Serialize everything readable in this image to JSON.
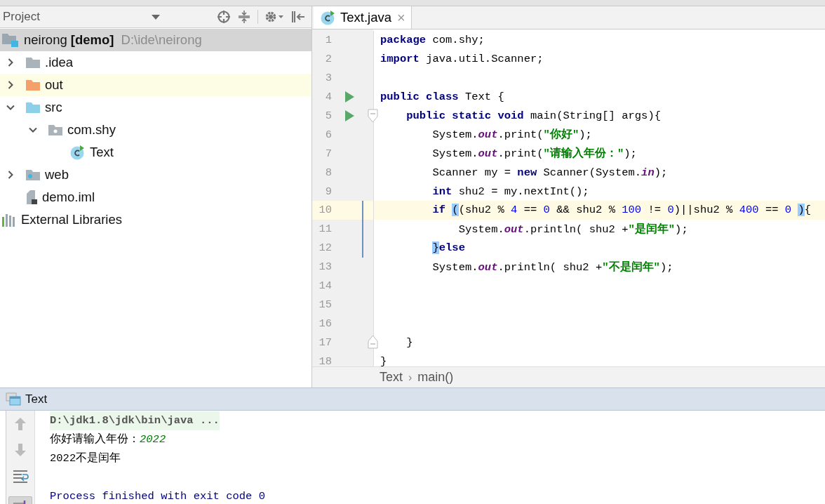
{
  "project_panel": {
    "title": "Project",
    "tree": [
      {
        "label": "neirong **[demo]**",
        "path": "D:\\ide\\neirong",
        "kind": "module",
        "selected": true,
        "highlighted": false,
        "children": [
          {
            "label": ".idea",
            "kind": "folder",
            "color": "#aab2ba",
            "expanded": false,
            "selected": false,
            "highlighted": false
          },
          {
            "label": "out",
            "kind": "folder",
            "color": "#f4a06b",
            "expanded": false,
            "selected": false,
            "highlighted": true
          },
          {
            "label": "src",
            "kind": "folder",
            "color": "#8cd0ea",
            "expanded": true,
            "selected": false,
            "highlighted": false,
            "children": [
              {
                "label": "com.shy",
                "kind": "package",
                "expanded": true,
                "selected": false,
                "highlighted": false,
                "children": [
                  {
                    "label": "Text",
                    "kind": "class",
                    "selected": false,
                    "highlighted": false
                  }
                ]
              }
            ]
          },
          {
            "label": "web",
            "kind": "web-folder",
            "expanded": false,
            "selected": false,
            "highlighted": false
          },
          {
            "label": "demo.iml",
            "kind": "file",
            "selected": false,
            "highlighted": false
          }
        ]
      },
      {
        "label": "External Libraries",
        "kind": "library",
        "selected": false,
        "highlighted": false
      }
    ]
  },
  "editor": {
    "tabs": [
      {
        "label": "Text.java",
        "close": "×",
        "selected": true
      }
    ],
    "lines": [
      {
        "number": "1",
        "current": false,
        "tokens": [
          {
            "t": "package",
            "kind": "kw"
          },
          {
            "t": " com.shy;",
            "kind": "plain"
          }
        ]
      },
      {
        "number": "2",
        "current": false,
        "tokens": [
          {
            "t": "import",
            "kind": "kw"
          },
          {
            "t": " java.util.Scanner;",
            "kind": "plain"
          }
        ]
      },
      {
        "number": "3",
        "current": false
      },
      {
        "number": "4",
        "current": false,
        "run": true,
        "tokens": [
          {
            "t": "public class",
            "kind": "kw"
          },
          {
            "t": " Text {",
            "kind": "plain"
          }
        ]
      },
      {
        "number": "5",
        "current": false,
        "run": true,
        "fold_marker": {
          "kind": "start"
        },
        "tokens": [
          {
            "t": "    public static void",
            "kind": "kw"
          },
          {
            "t": " main(String[] args){",
            "kind": "plain"
          }
        ]
      },
      {
        "number": "6",
        "current": false,
        "tokens": [
          {
            "t": "        System.",
            "kind": "plain"
          },
          {
            "t": "out",
            "kind": "field"
          },
          {
            "t": ".print(",
            "kind": "plain"
          },
          {
            "t": "\"你好\"",
            "kind": "str"
          },
          {
            "t": ");",
            "kind": "plain"
          }
        ]
      },
      {
        "number": "7",
        "current": false,
        "tokens": [
          {
            "t": "        System.",
            "kind": "plain"
          },
          {
            "t": "out",
            "kind": "field"
          },
          {
            "t": ".print(",
            "kind": "plain"
          },
          {
            "t": "\"请输入年份：\"",
            "kind": "str"
          },
          {
            "t": ");",
            "kind": "plain"
          }
        ]
      },
      {
        "number": "8",
        "current": false,
        "tokens": [
          {
            "t": "        Scanner my = ",
            "kind": "plain"
          },
          {
            "t": "new",
            "kind": "kw"
          },
          {
            "t": " Scanner(System.",
            "kind": "plain"
          },
          {
            "t": "in",
            "kind": "field"
          },
          {
            "t": ");",
            "kind": "plain"
          }
        ]
      },
      {
        "number": "9",
        "current": false,
        "tokens": [
          {
            "t": "        int",
            "kind": "kw"
          },
          {
            "t": " shu2 = my.nextInt();",
            "kind": "plain"
          }
        ]
      },
      {
        "number": "10",
        "current": true,
        "changed": true,
        "tokens": [
          {
            "t": "        if",
            "kind": "kw"
          },
          {
            "t": " (",
            "kind": "match"
          },
          {
            "t": "(shu2 % ",
            "kind": "plain"
          },
          {
            "t": "4",
            "kind": "num"
          },
          {
            "t": " == ",
            "kind": "plain"
          },
          {
            "t": "0",
            "kind": "num"
          },
          {
            "t": " && shu2 % ",
            "kind": "plain"
          },
          {
            "t": "100",
            "kind": "num"
          },
          {
            "t": " != ",
            "kind": "plain"
          },
          {
            "t": "0",
            "kind": "num"
          },
          {
            "t": ")||shu2 % ",
            "kind": "plain"
          },
          {
            "t": "400",
            "kind": "num"
          },
          {
            "t": " == ",
            "kind": "plain"
          },
          {
            "t": "0",
            "kind": "num"
          },
          {
            "t": " )",
            "kind": "match"
          },
          {
            "t": "{",
            "kind": "plain"
          }
        ]
      },
      {
        "number": "11",
        "current": false,
        "changed": true,
        "tokens": [
          {
            "t": "            System.",
            "kind": "plain"
          },
          {
            "t": "out",
            "kind": "field"
          },
          {
            "t": ".println( shu2 +",
            "kind": "plain"
          },
          {
            "t": "\"是闰年\"",
            "kind": "str"
          },
          {
            "t": ");",
            "kind": "plain"
          }
        ]
      },
      {
        "number": "12",
        "current": false,
        "changed": true,
        "tokens": [
          {
            "t": "        }",
            "kind": "match"
          },
          {
            "t": "else",
            "kind": "kw"
          }
        ]
      },
      {
        "number": "13",
        "current": false,
        "tokens": [
          {
            "t": "        System.",
            "kind": "plain"
          },
          {
            "t": "out",
            "kind": "field"
          },
          {
            "t": ".println( shu2 +",
            "kind": "plain"
          },
          {
            "t": "\"不是闰年\"",
            "kind": "str"
          },
          {
            "t": ");",
            "kind": "plain"
          }
        ]
      },
      {
        "number": "14",
        "current": false
      },
      {
        "number": "15",
        "current": false
      },
      {
        "number": "16",
        "current": false
      },
      {
        "number": "17",
        "current": false,
        "fold_marker": {
          "kind": "end"
        },
        "tokens": [
          {
            "t": "    }",
            "kind": "plain"
          }
        ]
      },
      {
        "number": "18",
        "current": false,
        "tokens": [
          {
            "t": "}",
            "kind": "plain"
          }
        ]
      }
    ],
    "breadcrumbs": [
      {
        "label": "Text"
      },
      {
        "label": "main()"
      }
    ],
    "breadcrumb_separator": "›"
  },
  "run_panel": {
    "title": "Text",
    "console": [
      {
        "kind": "command",
        "segments": [
          {
            "t": "D:\\jdk1.8\\jdk\\bin\\java ...",
            "kind": "command"
          }
        ]
      },
      {
        "kind": "output",
        "segments": [
          {
            "t": "你好请输入年份：",
            "kind": "stdout"
          },
          {
            "t": "2022",
            "kind": "input"
          }
        ]
      },
      {
        "kind": "output",
        "segments": [
          {
            "t": "2022不是闰年",
            "kind": "stdout"
          }
        ]
      },
      {
        "kind": "system",
        "segments": [
          {
            "t": "Process finished with exit code 0",
            "kind": "system"
          }
        ]
      }
    ]
  }
}
